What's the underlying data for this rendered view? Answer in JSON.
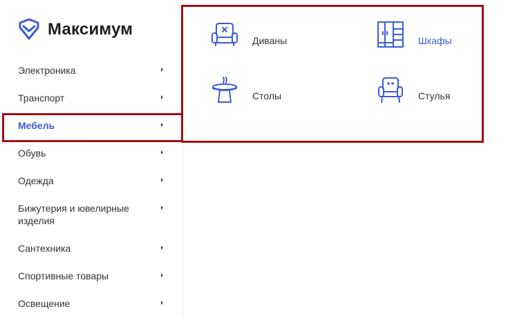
{
  "brand": {
    "name": "Максимум",
    "accent_color": "#3b5bd6",
    "highlight_color": "#a30f14"
  },
  "menu": {
    "items": [
      {
        "label": "Электроника"
      },
      {
        "label": "Транспорт"
      },
      {
        "label": "Мебель",
        "active": true
      },
      {
        "label": "Обувь"
      },
      {
        "label": "Одежда"
      },
      {
        "label": "Бижутерия и ювелирные изделия"
      },
      {
        "label": "Сантехника"
      },
      {
        "label": "Спортивные товары"
      },
      {
        "label": "Освещение"
      }
    ]
  },
  "submenu": {
    "items": [
      {
        "label": "Диваны",
        "icon": "sofa-icon"
      },
      {
        "label": "Шкафы",
        "icon": "wardrobe-icon",
        "hover": true
      },
      {
        "label": "Столы",
        "icon": "table-icon"
      },
      {
        "label": "Стулья",
        "icon": "armchair-icon"
      }
    ]
  }
}
